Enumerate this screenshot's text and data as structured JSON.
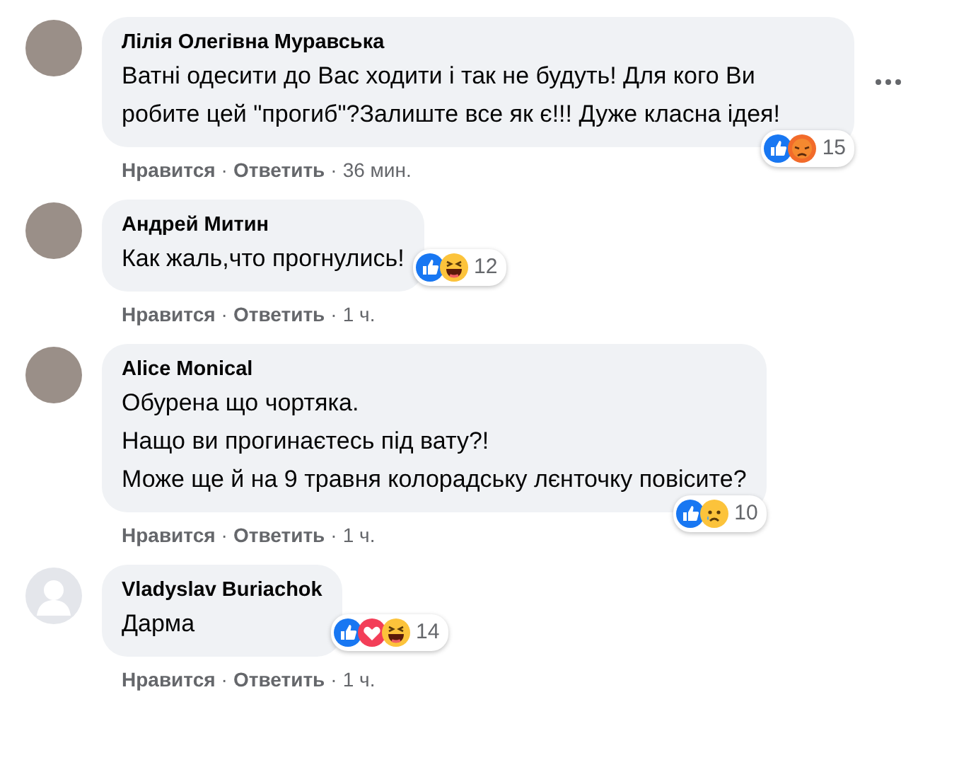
{
  "comments": [
    {
      "author": "Лілія Олегівна Муравська",
      "avatar": {
        "kind": "photo"
      },
      "text": "Ватні одесити до Вас ходити і так не будуть! Для кого Ви робите цей \"прогиб\"?Залиште все як є!!! Дуже класна ідея!",
      "more_menu": true,
      "reactions": [
        {
          "kind": "like"
        },
        {
          "kind": "angry"
        }
      ],
      "reaction_count": "15",
      "footer": [
        {
          "kind": "link",
          "text": "Нравится"
        },
        {
          "kind": "sep",
          "text": "·"
        },
        {
          "kind": "link",
          "text": "Ответить"
        },
        {
          "kind": "sep",
          "text": "·"
        },
        {
          "kind": "time",
          "text": "36 мин."
        }
      ]
    },
    {
      "author": "Андрей Митин",
      "avatar": {
        "kind": "photo"
      },
      "text": "Как жаль,что прогнулись!",
      "more_menu": false,
      "reactions": [
        {
          "kind": "like"
        },
        {
          "kind": "haha"
        }
      ],
      "reaction_count": "12",
      "footer": [
        {
          "kind": "link",
          "text": "Нравится"
        },
        {
          "kind": "sep",
          "text": "·"
        },
        {
          "kind": "link",
          "text": "Ответить"
        },
        {
          "kind": "sep",
          "text": "·"
        },
        {
          "kind": "time",
          "text": "1 ч."
        }
      ]
    },
    {
      "author": "Alice Monical",
      "avatar": {
        "kind": "photo"
      },
      "text": "Обурена що чортяка.\nНащо ви прогинаєтесь під вату?!\nМоже ще й на 9 травня колорадську лєнточку повісите?",
      "more_menu": false,
      "reactions": [
        {
          "kind": "like"
        },
        {
          "kind": "sad"
        }
      ],
      "reaction_count": "10",
      "footer": [
        {
          "kind": "link",
          "text": "Нравится"
        },
        {
          "kind": "sep",
          "text": "·"
        },
        {
          "kind": "link",
          "text": "Ответить"
        },
        {
          "kind": "sep",
          "text": "·"
        },
        {
          "kind": "time",
          "text": "1 ч."
        }
      ]
    },
    {
      "author": "Vladyslav Buriachok",
      "avatar": {
        "kind": "default"
      },
      "text": "Дарма",
      "more_menu": false,
      "reactions": [
        {
          "kind": "like"
        },
        {
          "kind": "love"
        },
        {
          "kind": "haha"
        }
      ],
      "reaction_count": "14",
      "footer": [
        {
          "kind": "link",
          "text": "Нравится"
        },
        {
          "kind": "sep",
          "text": "·"
        },
        {
          "kind": "link",
          "text": "Ответить"
        },
        {
          "kind": "sep",
          "text": "·"
        },
        {
          "kind": "time",
          "text": "1 ч."
        }
      ]
    }
  ]
}
